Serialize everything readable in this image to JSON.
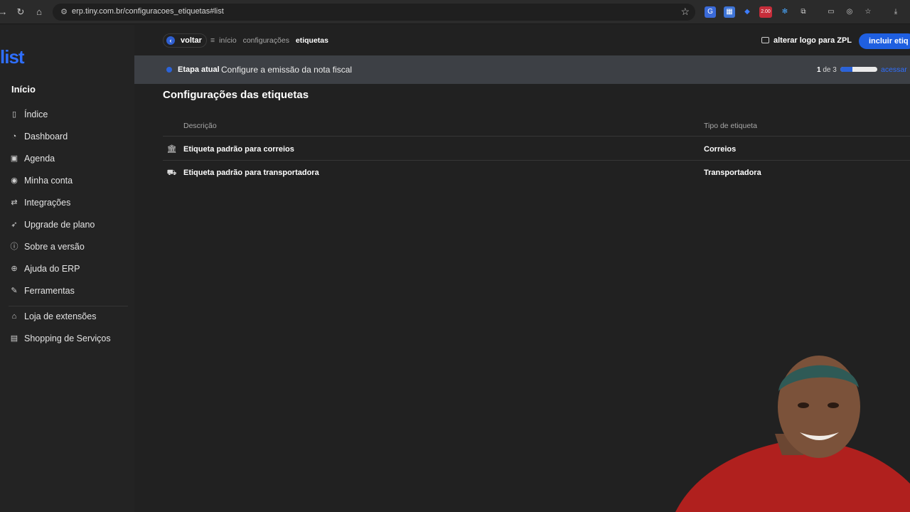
{
  "browser": {
    "url": "erp.tiny.com.br/configuracoes_etiquetas#list",
    "icons": [
      "back-icon",
      "reload-icon",
      "home-icon",
      "site-settings-icon",
      "bookmark-star-icon",
      "download-icon"
    ],
    "extension_badge": "2.00"
  },
  "sidebar": {
    "logo": "list",
    "heading": "Início",
    "items": [
      {
        "label": "Índice",
        "icon": "book-icon"
      },
      {
        "label": "Dashboard",
        "icon": "dashboard-icon"
      },
      {
        "label": "Agenda",
        "icon": "calendar-icon"
      },
      {
        "label": "Minha conta",
        "icon": "account-icon"
      },
      {
        "label": "Integrações",
        "icon": "arrows-icon"
      },
      {
        "label": "Upgrade de plano",
        "icon": "rocket-icon"
      },
      {
        "label": "Sobre a versão",
        "icon": "info-icon"
      },
      {
        "label": "Ajuda do ERP",
        "icon": "help-icon"
      },
      {
        "label": "Ferramentas",
        "icon": "wrench-icon"
      },
      {
        "label": "Loja de extensões",
        "icon": "store-icon"
      },
      {
        "label": "Shopping de Serviços",
        "icon": "shop-icon"
      }
    ]
  },
  "topbar": {
    "back_label": "voltar",
    "breadcrumb": [
      "início",
      "configurações",
      "etiquetas"
    ],
    "zpl_label": "alterar logo para ZPL",
    "primary_label": "incluir etiq"
  },
  "stepbar": {
    "label": "Etapa atual",
    "text": "Configure a emissão da nota fiscal",
    "current": "1",
    "of_total": "de 3",
    "progress": 0.33,
    "access": "acessar"
  },
  "page": {
    "title": "Configurações das etiquetas"
  },
  "table": {
    "headers": {
      "description": "Descrição",
      "type": "Tipo de etiqueta"
    },
    "rows": [
      {
        "description": "Etiqueta padrão para correios",
        "type": "Correios",
        "icon": "bank-icon"
      },
      {
        "description": "Etiqueta padrão para transportadora",
        "type": "Transportadora",
        "icon": "truck-icon"
      }
    ]
  },
  "colors": {
    "accent": "#1f5fe0",
    "background": "#212121",
    "stepbar": "#3d4045",
    "webcam_shirt": "#b0201e"
  }
}
